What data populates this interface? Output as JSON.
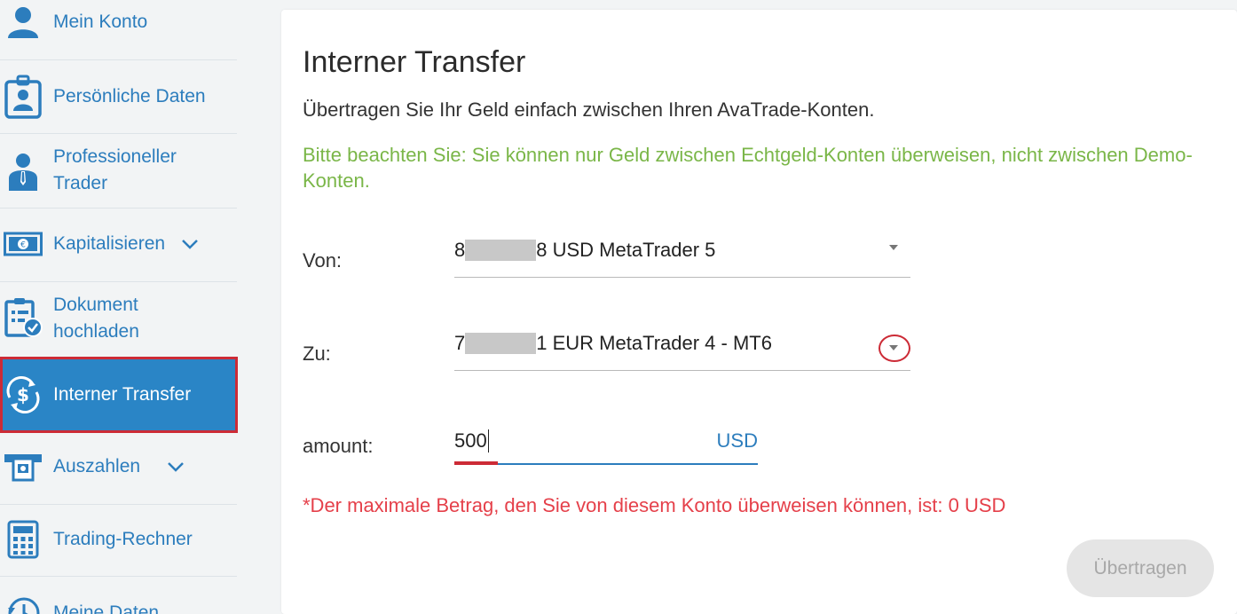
{
  "sidebar": {
    "items": [
      {
        "label": "Mein Konto",
        "icon": "user-icon"
      },
      {
        "label": "Persönliche Daten",
        "icon": "id-badge-icon"
      },
      {
        "label": "Professioneller",
        "label2": "Trader",
        "icon": "businessman-icon"
      },
      {
        "label": "Kapitalisieren",
        "icon": "banknote-icon"
      },
      {
        "label": "Dokument",
        "label2": "hochladen",
        "icon": "document-check-icon"
      },
      {
        "label": "Interner Transfer",
        "icon": "dollar-transfer-icon"
      },
      {
        "label": "Auszahlen",
        "icon": "withdraw-icon"
      },
      {
        "label": "Trading-Rechner",
        "icon": "calculator-icon"
      },
      {
        "label": "Meine Daten",
        "icon": "clock-icon"
      }
    ],
    "active_index": 5,
    "accent": "#2a85c6"
  },
  "main": {
    "title": "Interner Transfer",
    "subtitle": "Übertragen Sie Ihr Geld einfach zwischen Ihren AvaTrade-Konten.",
    "note": "Bitte beachten Sie: Sie können nur Geld zwischen Echtgeld-Konten überweisen, nicht zwischen Demo-Konten.",
    "from": {
      "label": "Von:",
      "prefix": "8",
      "suffix": "8 USD MetaTrader 5"
    },
    "to": {
      "label": "Zu:",
      "prefix": "7",
      "suffix": "1 EUR MetaTrader 4 - MT6"
    },
    "amount": {
      "label": "amount:",
      "value": "500",
      "currency": "USD"
    },
    "error": "*Der maximale Betrag, den Sie von diesem Konto überweisen können, ist: 0 USD",
    "submit_label": "Übertragen"
  },
  "colors": {
    "link": "#2c7dbd",
    "note": "#7ab648",
    "error": "#e5404a",
    "highlight": "#cc2b36"
  }
}
